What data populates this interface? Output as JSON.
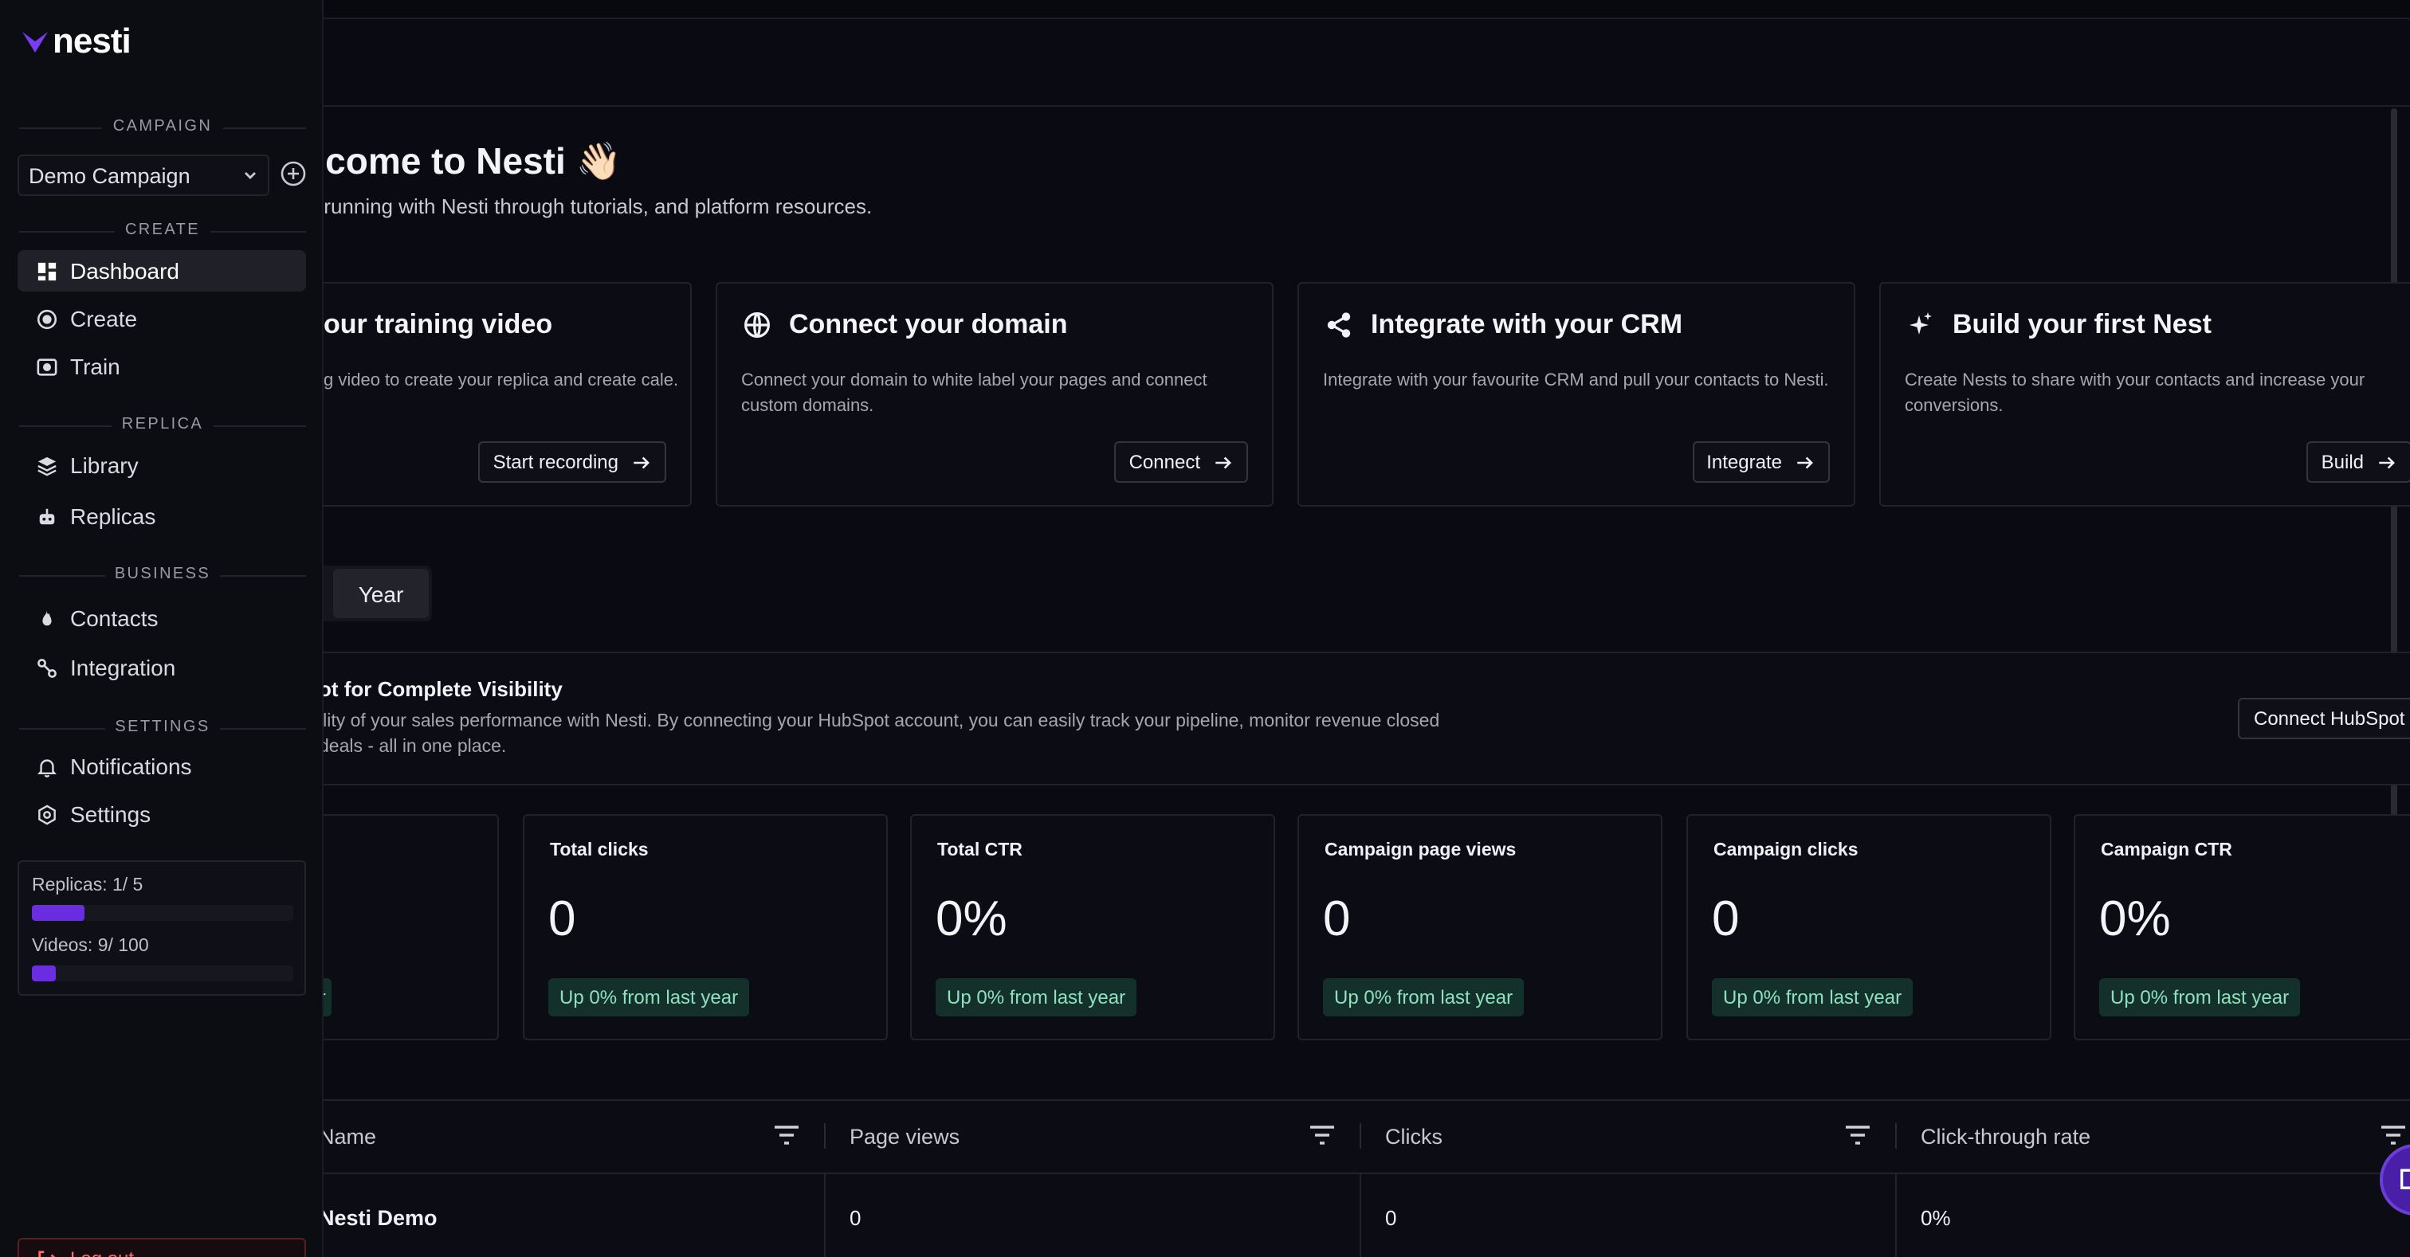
{
  "sidebar": {
    "logo_text": "nesti",
    "sections": {
      "campaign": "CAMPAIGN",
      "create": "CREATE",
      "replica": "REPLICA",
      "business": "BUSINESS",
      "settings": "SETTINGS"
    },
    "campaign_select": {
      "value": "Demo Campaign"
    },
    "nav": {
      "dashboard": "Dashboard",
      "create": "Create",
      "train": "Train",
      "library": "Library",
      "replicas": "Replicas",
      "contacts": "Contacts",
      "integration": "Integration",
      "notifications": "Notifications",
      "settings": "Settings"
    },
    "usage": {
      "replicas_label": "Replicas: 1/ 5",
      "replicas_fraction": 0.2,
      "videos_label": "Videos: 9/ 100",
      "videos_fraction": 0.09
    },
    "logout_label": "Log out"
  },
  "main": {
    "welcome_title": "welcome to Nesti 👋🏻",
    "welcome_sub": "o and running with Nesti through tutorials, and platform resources.",
    "cards": [
      {
        "title": "our training video",
        "desc": "g video to create your replica and create cale.",
        "button": "Start recording",
        "icon": "video-icon"
      },
      {
        "title": "Connect your domain",
        "desc": "Connect your domain to white label your pages and connect custom domains.",
        "button": "Connect",
        "icon": "globe-icon"
      },
      {
        "title": "Integrate with your CRM",
        "desc": "Integrate with your favourite CRM and pull your contacts to Nesti.",
        "button": "Integrate",
        "icon": "share-icon"
      },
      {
        "title": "Build your first Nest",
        "desc": "Create Nests to share with your contacts and increase your conversions.",
        "button": "Build",
        "icon": "sparkle-icon"
      }
    ],
    "period_selected": "Year",
    "hubspot": {
      "title": "ot for Complete Visibility",
      "desc": "ility of your sales performance with Nesti. By connecting your HubSpot account, you can easily track your pipeline, monitor revenue closed deals - all in one place.",
      "button": "Connect HubSpot"
    },
    "stats": [
      {
        "label": "",
        "value": "",
        "badge": "ear"
      },
      {
        "label": "Total clicks",
        "value": "0",
        "badge": "Up 0% from last year"
      },
      {
        "label": "Total CTR",
        "value": "0%",
        "badge": "Up 0% from last year"
      },
      {
        "label": "Campaign page views",
        "value": "0",
        "badge": "Up 0% from last year"
      },
      {
        "label": "Campaign clicks",
        "value": "0",
        "badge": "Up 0% from last year"
      },
      {
        "label": "Campaign CTR",
        "value": "0%",
        "badge": "Up 0% from last year"
      }
    ],
    "table": {
      "headers": [
        "Name",
        "Page views",
        "Clicks",
        "Click-through rate"
      ],
      "rows": [
        {
          "name": "Nesti Demo",
          "page_views": "0",
          "clicks": "0",
          "ctr": "0%"
        }
      ]
    }
  },
  "colors": {
    "background": "#08080f",
    "sidebar": "#0c0c13",
    "accent": "#6a2ee0",
    "success_badge_bg": "#14302a",
    "success_badge_text": "#8ee0bf",
    "danger": "#ff6b6b"
  }
}
